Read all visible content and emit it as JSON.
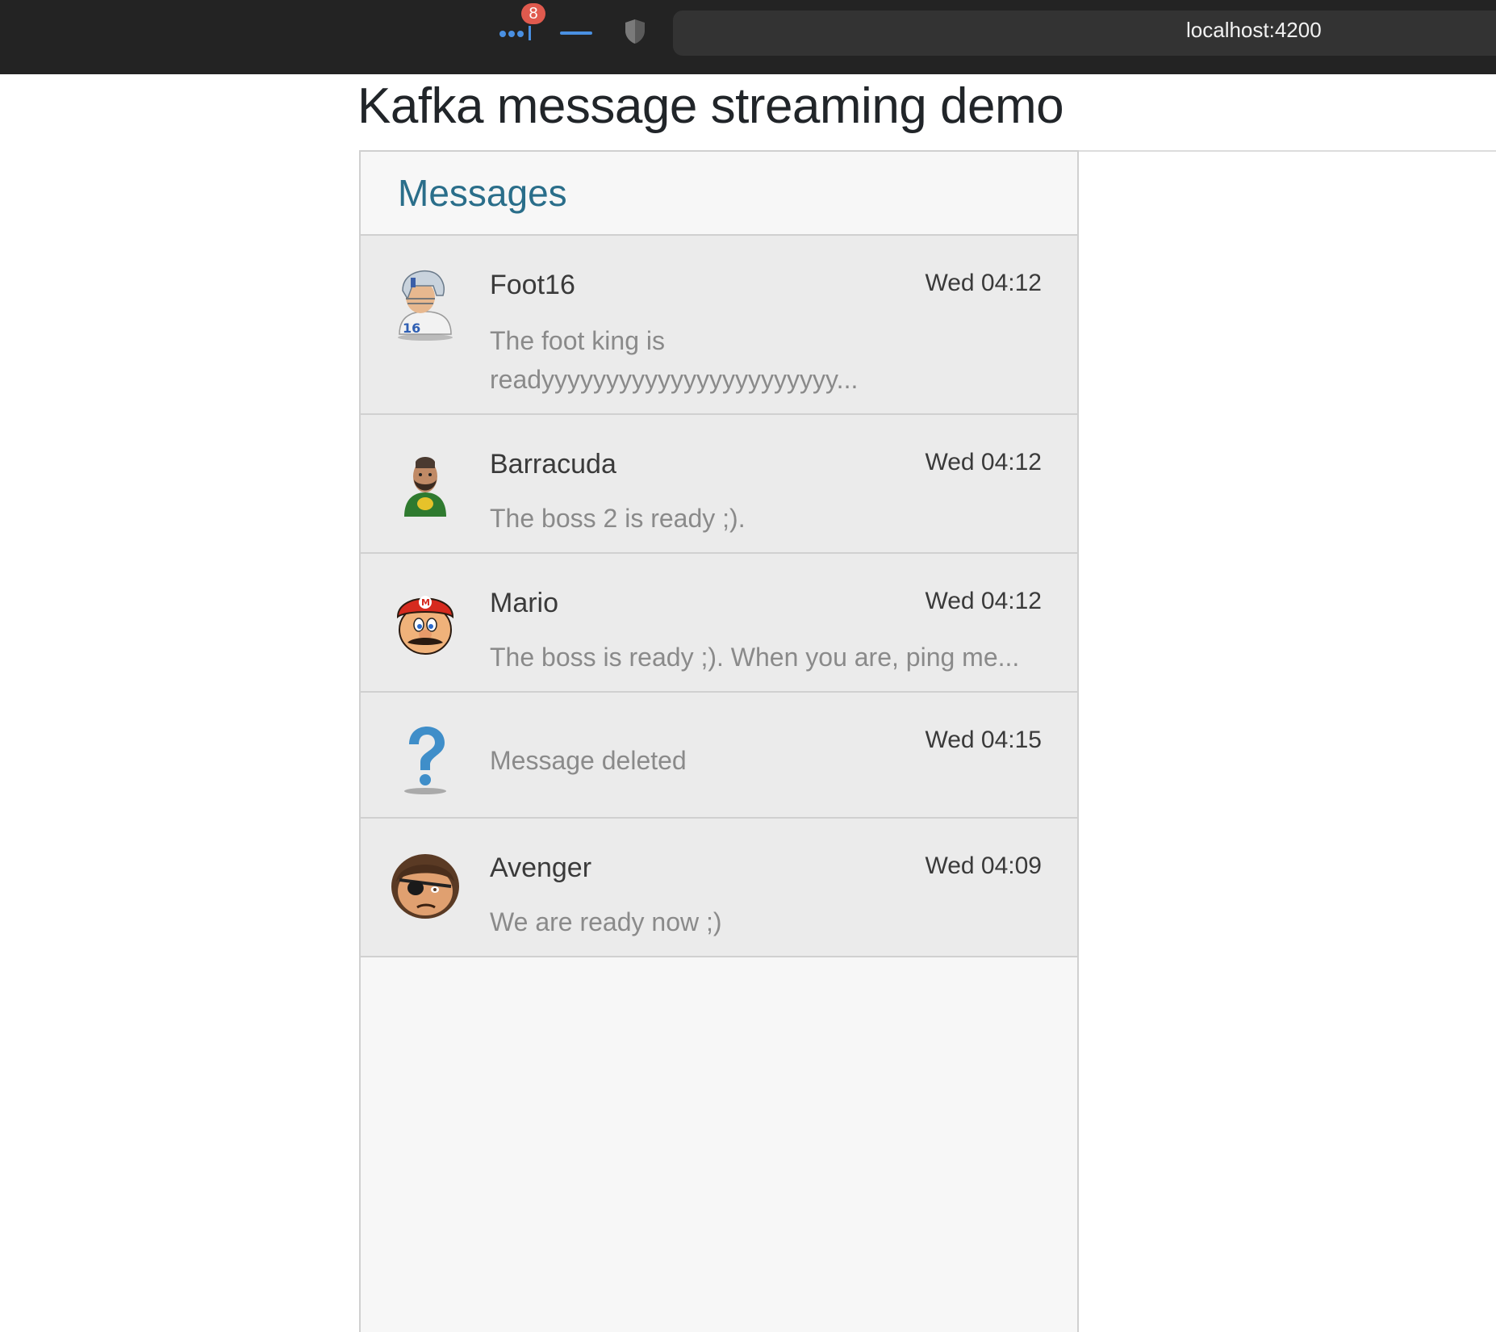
{
  "browser": {
    "extension_badge": "8",
    "url": "localhost:4200"
  },
  "page": {
    "title": "Kafka message streaming demo"
  },
  "panel": {
    "title": "Messages",
    "messages": [
      {
        "sender": "Foot16",
        "time": "Wed 04:12",
        "preview_line1": "The foot king is",
        "preview_line2": "readyyyyyyyyyyyyyyyyyyyyyyy...",
        "avatar": "football-player-icon"
      },
      {
        "sender": "Barracuda",
        "time": "Wed 04:12",
        "preview": "The boss 2 is ready ;).",
        "avatar": "bearded-man-icon"
      },
      {
        "sender": "Mario",
        "time": "Wed 04:12",
        "preview": "The boss is ready ;). When you are, ping me...",
        "avatar": "mario-icon"
      },
      {
        "sender": "",
        "time": "Wed 04:15",
        "preview": "Message deleted",
        "avatar": "question-mark-icon"
      },
      {
        "sender": "Avenger",
        "time": "Wed 04:09",
        "preview": "We are ready now ;)",
        "avatar": "eyepatch-man-icon"
      }
    ]
  },
  "colors": {
    "topbar": "#232323",
    "accent_blue": "#4a90e2",
    "panel_title": "#2a6e8a",
    "badge": "#e05a4e"
  }
}
